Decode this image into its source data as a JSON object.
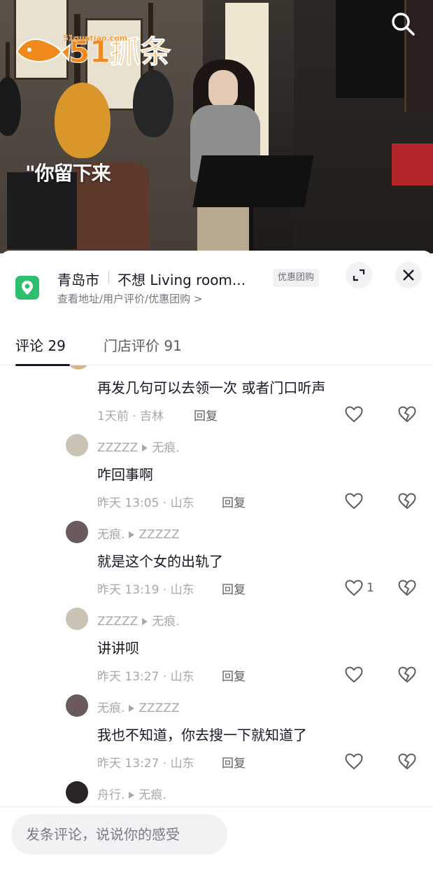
{
  "video": {
    "watermark": {
      "brand": "51抓条",
      "url": "51guatiao.com"
    },
    "lyric": "\"你留下来"
  },
  "location": {
    "city": "青岛市",
    "name": "不想 Living room...",
    "badge": "优惠团购",
    "subtitle": "查看地址/用户评价/优惠团购 >"
  },
  "tabs": [
    {
      "label": "评论 29",
      "active": true
    },
    {
      "label": "门店评价 91",
      "active": false
    }
  ],
  "comments": [
    {
      "author": null,
      "target": null,
      "text": "再发几句可以去领一次 或者门口听声",
      "meta": "1天前 · 吉林",
      "reply": "回复",
      "likes": ""
    },
    {
      "author": "ZZZZZ",
      "target": "无痕.",
      "text": "咋回事啊",
      "meta": "昨天 13:05 · 山东",
      "reply": "回复",
      "likes": ""
    },
    {
      "author": "无痕.",
      "target": "ZZZZZ",
      "text": "就是这个女的出轨了",
      "meta": "昨天 13:19 · 山东",
      "reply": "回复",
      "likes": "1"
    },
    {
      "author": "ZZZZZ",
      "target": "无痕.",
      "text": "讲讲呗",
      "meta": "昨天 13:27 · 山东",
      "reply": "回复",
      "likes": ""
    },
    {
      "author": "无痕.",
      "target": "ZZZZZ",
      "text": "我也不知道，你去搜一下就知道了",
      "meta": "昨天 13:27 · 山东",
      "reply": "回复",
      "likes": ""
    },
    {
      "author": "舟行.",
      "target": "无痕.",
      "text": "",
      "meta": "",
      "reply": "",
      "likes": ""
    }
  ],
  "input": {
    "placeholder": "发条评论，说说你的感受"
  },
  "colors": {
    "location_pin": "#2dbf6e",
    "watermark": "#f08a1c"
  }
}
